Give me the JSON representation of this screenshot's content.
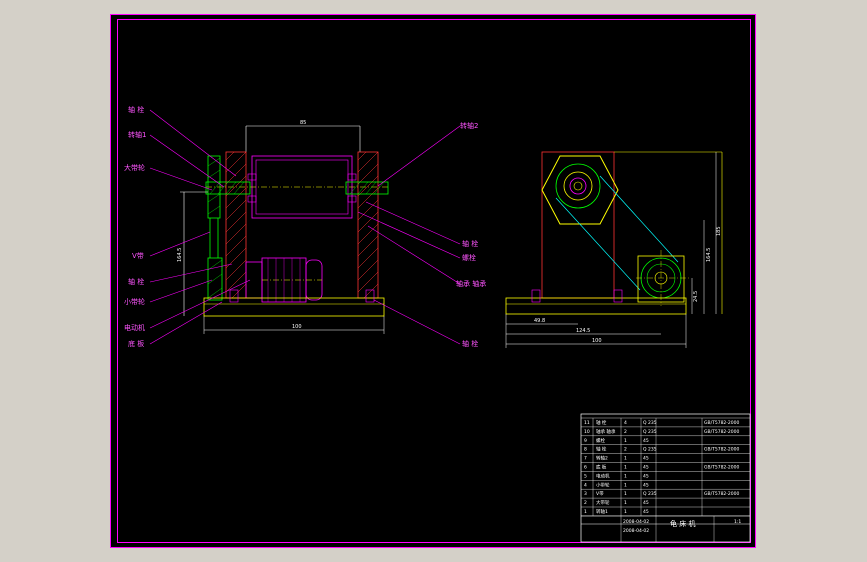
{
  "drawing": {
    "background": "#000000",
    "frame_color": "#ff00ff",
    "line_color": "#ffff00",
    "hatch_color": "#ff3333",
    "cyan_color": "#00ffff",
    "green_color": "#00ff00",
    "dim_color": "#ffffff"
  },
  "labels_left": [
    "轴 栓",
    "转轴1",
    "大带轮",
    "V带",
    "轴 栓",
    "小带轮",
    "电动机",
    "底 板"
  ],
  "labels_right": [
    "转轴2",
    "轴 栓",
    "螺栓",
    "轴承 轴承",
    "轴 栓"
  ],
  "dimensions": {
    "top_width": "85",
    "left_height": "164.5",
    "front_base": "100",
    "side_height": "185",
    "side_height2": "164.5",
    "side_small": "24.5",
    "side_w1": "49.8",
    "side_w2": "124.5",
    "side_base": "100"
  },
  "title_block": {
    "title": "龟 床 机",
    "date1": "2008-04-02",
    "date2": "2008-04-02",
    "scale": "1:1",
    "rows": [
      {
        "no": "11",
        "name": "轴 栓",
        "qty": "4",
        "material": "Q 235",
        "note": "GB/T5782-2000"
      },
      {
        "no": "10",
        "name": "轴承 轴承",
        "qty": "2",
        "material": "Q 235",
        "note": "GB/T5782-2000"
      },
      {
        "no": "9",
        "name": "螺栓",
        "qty": "1",
        "material": "45",
        "note": ""
      },
      {
        "no": "8",
        "name": "轴 栓",
        "qty": "2",
        "material": "Q 235",
        "note": "GB/T5782-2000"
      },
      {
        "no": "7",
        "name": "转轴2",
        "qty": "1",
        "material": "45",
        "note": ""
      },
      {
        "no": "6",
        "name": "底 板",
        "qty": "1",
        "material": "45",
        "note": "GB/T5782-2000"
      },
      {
        "no": "5",
        "name": "电动机",
        "qty": "1",
        "material": "45",
        "note": ""
      },
      {
        "no": "4",
        "name": "小带轮",
        "qty": "1",
        "material": "45",
        "note": ""
      },
      {
        "no": "3",
        "name": "V带",
        "qty": "1",
        "material": "Q 235",
        "note": "GB/T5782-2000"
      },
      {
        "no": "2",
        "name": "大带轮",
        "qty": "1",
        "material": "45",
        "note": ""
      },
      {
        "no": "1",
        "name": "转轴1",
        "qty": "1",
        "material": "45",
        "note": ""
      }
    ]
  }
}
